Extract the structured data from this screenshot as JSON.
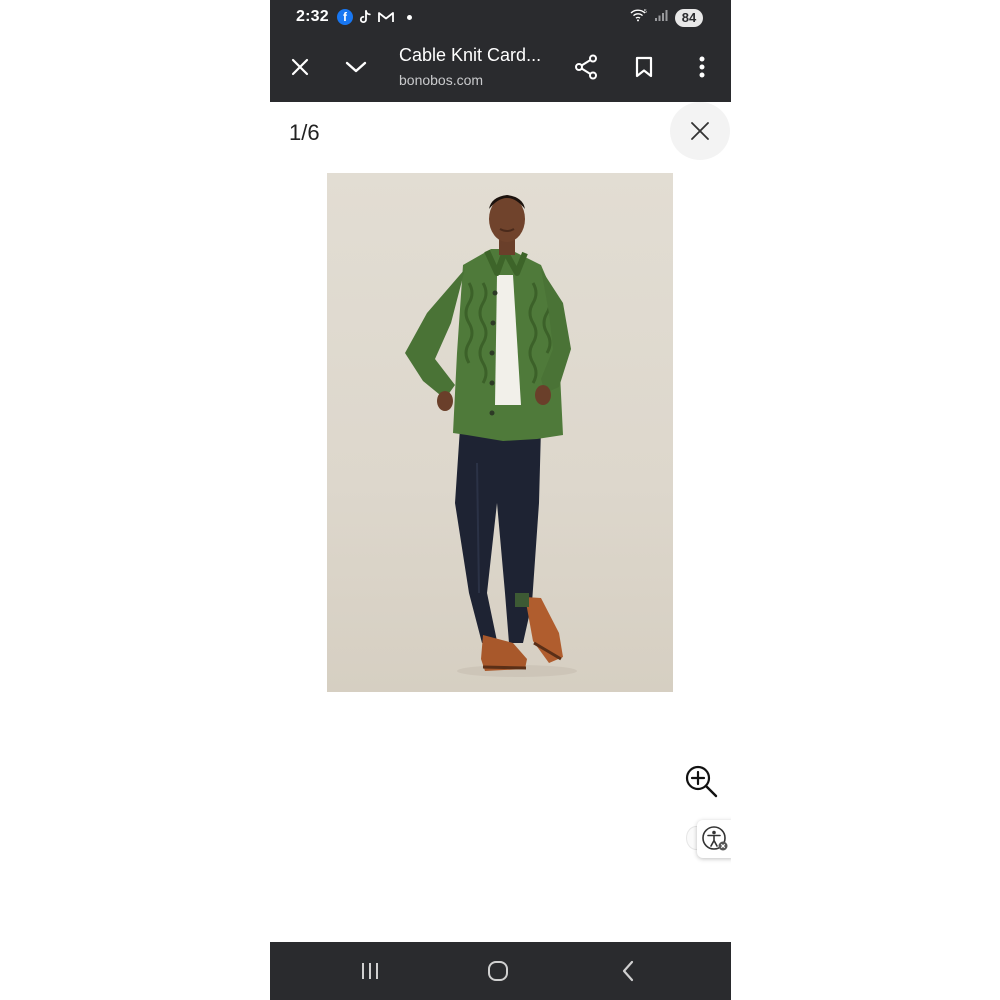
{
  "status_bar": {
    "time": "2:32",
    "notification_icons": [
      "facebook-icon",
      "tiktok-icon",
      "gmail-icon",
      "more-notifications-dot"
    ],
    "system_icons": [
      "wifi-icon",
      "signal-icon"
    ],
    "battery": "84"
  },
  "toolbar": {
    "title": "Cable Knit Card...",
    "url": "bonobos.com",
    "icons": [
      "close-icon",
      "chevron-down-icon",
      "share-icon",
      "bookmark-icon",
      "more-vert-icon"
    ]
  },
  "gallery": {
    "counter": "1/6",
    "image_description": "Model wearing green cable knit cardigan, white tee, dark jeans, brown suede shoes"
  },
  "controls": {
    "zoom_icon": "zoom-in-icon",
    "accessibility_icon": "accessibility-icon"
  },
  "nav_bar": {
    "icons": [
      "recents-icon",
      "home-icon",
      "back-icon"
    ]
  },
  "colors": {
    "bar_background": "#2a2b2e",
    "facebook_blue": "#1877f2",
    "photo_background": "#e0dbd1",
    "cardigan_green": "#4f7a3a"
  }
}
